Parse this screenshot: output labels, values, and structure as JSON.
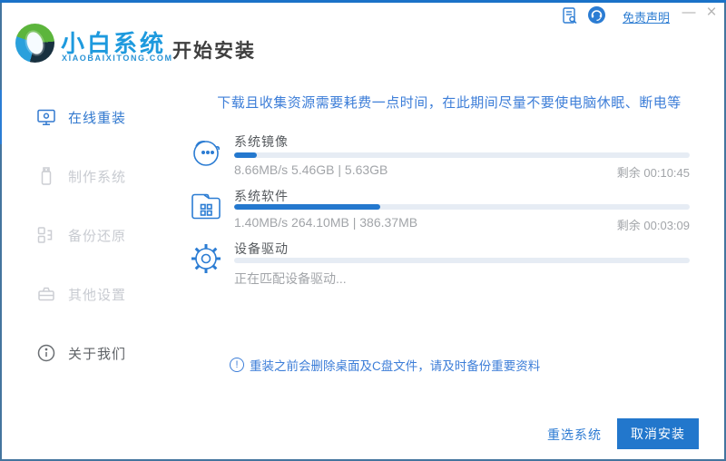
{
  "window": {
    "brand_name": "小白系统",
    "brand_domain": "XIAOBAIXITONG.COM",
    "page_title": "开始安装",
    "titlebar": {
      "disclaimer_link": "免责声明",
      "minimize_glyph": "—",
      "close_glyph": "×",
      "icons": [
        "document-disclaimer-icon",
        "customer-service-icon"
      ]
    }
  },
  "sidebar": {
    "items": [
      {
        "label": "在线重装",
        "icon": "monitor-reinstall-icon",
        "state": "active"
      },
      {
        "label": "制作系统",
        "icon": "usb-drive-icon",
        "state": "disabled"
      },
      {
        "label": "备份还原",
        "icon": "backup-restore-icon",
        "state": "disabled"
      },
      {
        "label": "其他设置",
        "icon": "toolbox-icon",
        "state": "disabled"
      },
      {
        "label": "关于我们",
        "icon": "info-icon",
        "state": "normal"
      }
    ]
  },
  "main": {
    "warning": "下载且收集资源需要耗费一点时间，在此期间尽量不要使电脑休眠、断电等",
    "tasks": [
      {
        "name": "系统镜像",
        "icon": "face-chat-icon",
        "progress_percent": 5,
        "stats": "8.66MB/s 5.46GB | 5.63GB",
        "remaining": "剩余 00:10:45"
      },
      {
        "name": "系统软件",
        "icon": "folder-apps-icon",
        "progress_percent": 32,
        "stats": "1.40MB/s 264.10MB | 386.37MB",
        "remaining": "剩余 00:03:09"
      },
      {
        "name": "设备驱动",
        "icon": "gear-icon",
        "progress_percent": 0,
        "stats": "正在匹配设备驱动...",
        "remaining": ""
      }
    ],
    "notice": "重装之前会删除桌面及C盘文件，请及时备份重要资料",
    "notice_icon": "circle-exclamation-icon",
    "footer": {
      "reselect_label": "重选系统",
      "cancel_label": "取消安装"
    }
  },
  "colors": {
    "accent_blue": "#2478ce",
    "warning_text": "#3d7ed8",
    "brand_blue": "#1e9ade",
    "border_top": "#1a72c8",
    "border_frame": "#44759e",
    "progress_track": "#e6ecf4",
    "inactive_gray": "#c8cbd1"
  }
}
